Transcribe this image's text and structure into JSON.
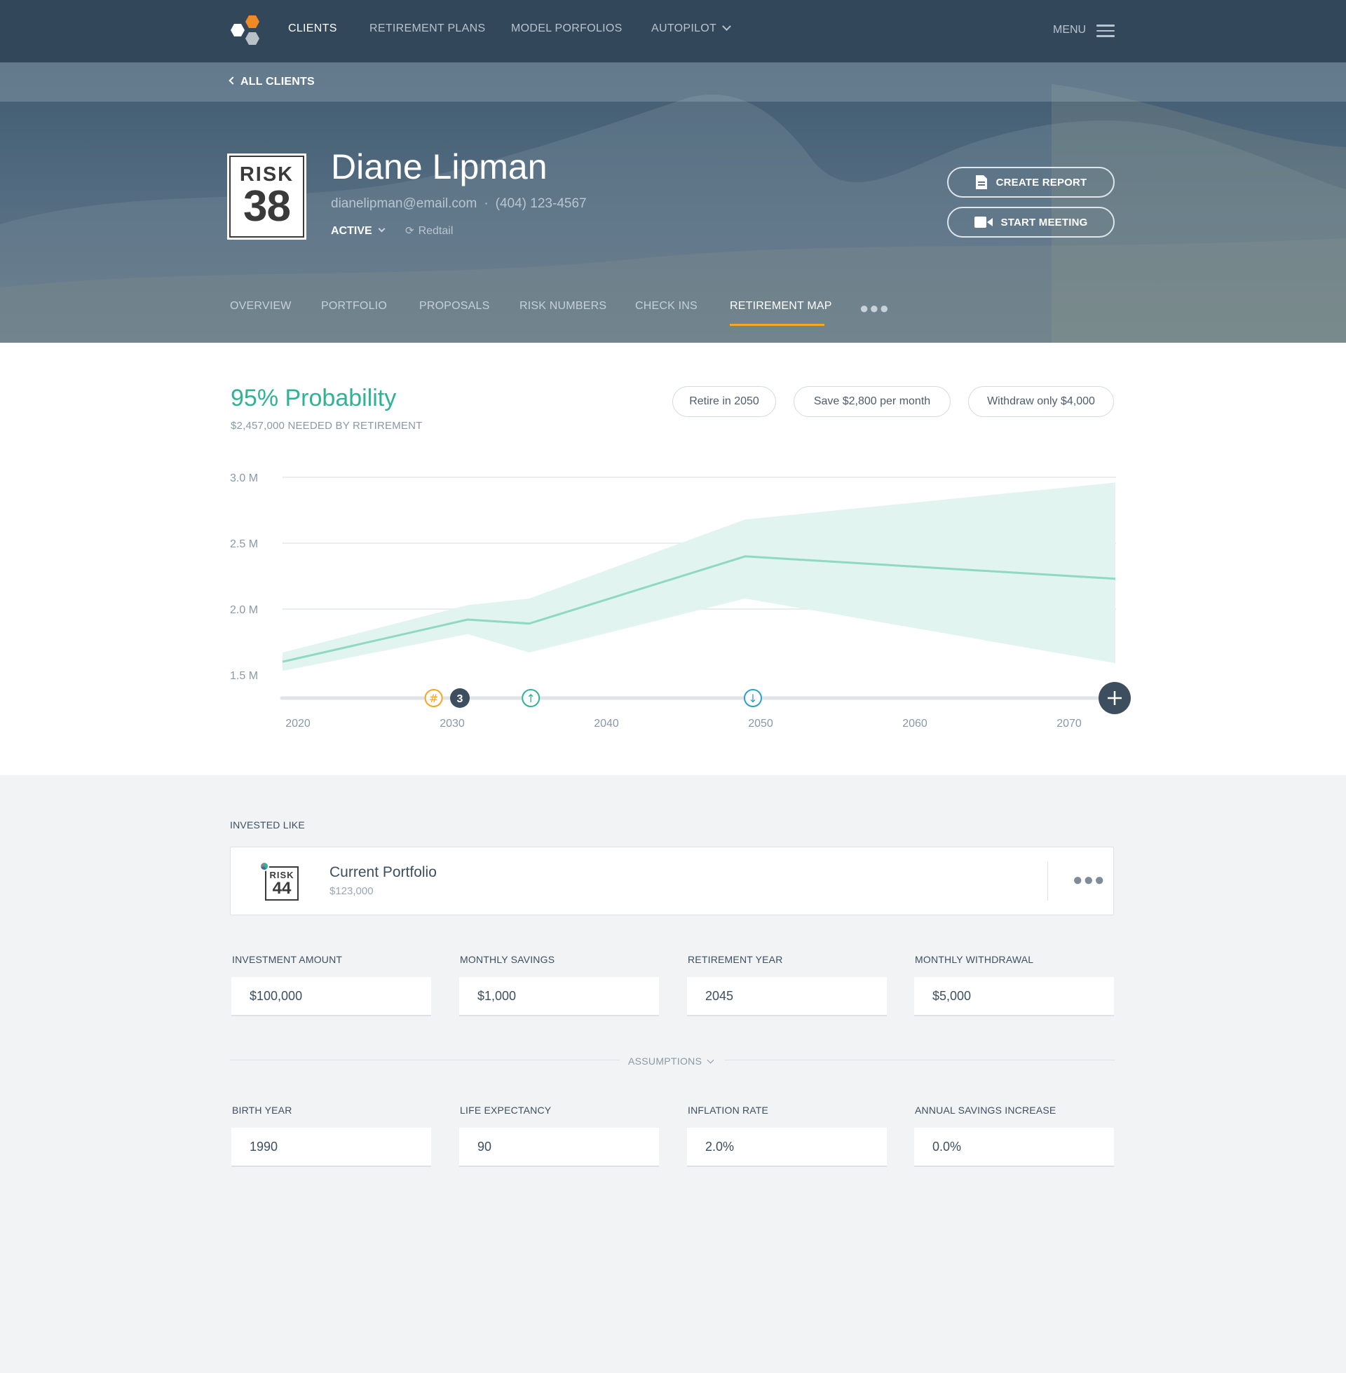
{
  "nav": {
    "items": [
      "CLIENTS",
      "RETIREMENT PLANS",
      "MODEL PORFOLIOS",
      "AUTOPILOT"
    ],
    "menu_label": "MENU"
  },
  "breadcrumb": {
    "back_label": "ALL CLIENTS"
  },
  "client": {
    "risk_label": "RISK",
    "risk_number": "38",
    "name": "Diane Lipman",
    "email": "dianelipman@email.com",
    "separator": "·",
    "phone": "(404) 123-4567",
    "status": "ACTIVE",
    "integration": "Redtail"
  },
  "actions": {
    "create_report": "CREATE REPORT",
    "start_meeting": "START MEETING"
  },
  "tabs": [
    "OVERVIEW",
    "PORTFOLIO",
    "PROPOSALS",
    "RISK NUMBERS",
    "CHECK INS",
    "RETIREMENT MAP"
  ],
  "active_tab": "RETIREMENT MAP",
  "summary": {
    "probability": "95% Probability",
    "needed": "$2,457,000 NEEDED BY RETIREMENT",
    "suggestions": [
      "Retire in 2050",
      "Save $2,800 per month",
      "Withdraw only $4,000"
    ]
  },
  "chart_data": {
    "type": "area",
    "x": [
      2019,
      2031,
      2035,
      2049,
      2073
    ],
    "series": [
      {
        "values": [
          1.6,
          1.92,
          1.89,
          2.4,
          2.23
        ]
      }
    ],
    "band_upper": [
      1.67,
      2.03,
      2.08,
      2.68,
      2.96
    ],
    "band_lower": [
      1.53,
      1.81,
      1.67,
      2.08,
      1.59
    ],
    "y_ticks": [
      "3.0 M",
      "2.5 M",
      "2.0 M",
      "1.5 M"
    ],
    "y_tick_values": [
      3.0,
      2.5,
      2.0,
      1.5
    ],
    "x_ticks": [
      "2020",
      "2030",
      "2040",
      "2050",
      "2060",
      "2070"
    ],
    "x_tick_values": [
      2020,
      2030,
      2040,
      2050,
      2060,
      2070
    ],
    "xlim": [
      2019,
      2073
    ],
    "ylim": [
      1.5,
      3.0
    ],
    "grid": true,
    "line_color": "#8fd9c3",
    "band_color": "#e2f4ef",
    "events": [
      {
        "year": 2028.8,
        "kind": "goal",
        "label": "#",
        "color": "#f5a623"
      },
      {
        "year": 2030.5,
        "kind": "group",
        "label": "3",
        "color": "#3d4f5f"
      },
      {
        "year": 2035.1,
        "kind": "deposit",
        "label": "↑",
        "color": "#2fb394"
      },
      {
        "year": 2049.5,
        "kind": "withdrawal",
        "label": "↓",
        "color": "#2d9fd0"
      }
    ],
    "add_event_icon": "plus-icon"
  },
  "invested": {
    "section_label": "INVESTED LIKE",
    "risk_label": "RISK",
    "risk_number": "44",
    "name": "Current Portfolio",
    "value": "$123,000"
  },
  "inputs": [
    {
      "label": "INVESTMENT AMOUNT",
      "value": "$100,000"
    },
    {
      "label": "MONTHLY SAVINGS",
      "value": "$1,000"
    },
    {
      "label": "RETIREMENT YEAR",
      "value": "2045"
    },
    {
      "label": "MONTHLY WITHDRAWAL",
      "value": "$5,000"
    }
  ],
  "assumptions_label": "ASSUMPTIONS",
  "assumptions": [
    {
      "label": "BIRTH YEAR",
      "value": "1990"
    },
    {
      "label": "LIFE EXPECTANCY",
      "value": "90"
    },
    {
      "label": "INFLATION RATE",
      "value": "2.0%"
    },
    {
      "label": "ANNUAL SAVINGS INCREASE",
      "value": "0.0%"
    }
  ],
  "colors": {
    "accent": "#2fb394",
    "tab_underline": "#f5a623",
    "nav_bg": "#33475a"
  }
}
